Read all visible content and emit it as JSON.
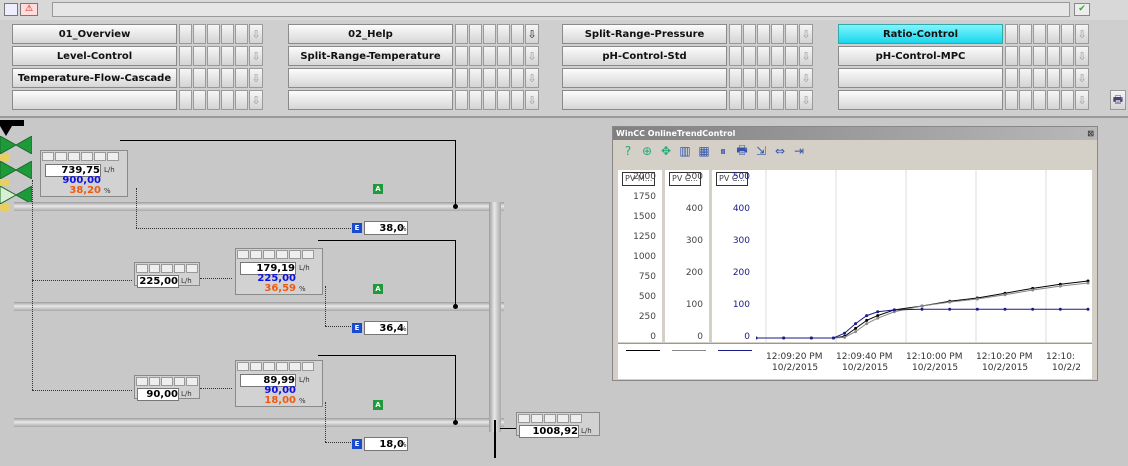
{
  "nav": {
    "rows": [
      [
        "01_Overview",
        "02_Help",
        "Split-Range-Pressure",
        "Ratio-Control"
      ],
      [
        "Level-Control",
        "Split-Range-Temperature",
        "pH-Control-Std",
        "pH-Control-MPC"
      ],
      [
        "Temperature-Flow-Cascade",
        "",
        "",
        ""
      ],
      [
        "",
        "",
        "",
        ""
      ]
    ],
    "active": "Ratio-Control",
    "arrow_glyph": "⇩"
  },
  "process": {
    "fic1": {
      "pv": "739,75",
      "sp": "900,00",
      "out": "38,20",
      "unit": "L/h",
      "out_unit": "%",
      "valve_out": "38,0",
      "valve_out_unit": "%"
    },
    "fic2": {
      "pv": "179,19",
      "sp": "225,00",
      "out": "36,59",
      "unit": "L/h",
      "out_unit": "%",
      "valve_out": "36,4",
      "valve_out_unit": "%"
    },
    "ratio2": {
      "value": "225,00",
      "unit": "L/h"
    },
    "fic3": {
      "pv": "89,99",
      "sp": "90,00",
      "out": "18,00",
      "unit": "L/h",
      "out_unit": "%",
      "valve_out": "18,0",
      "valve_out_unit": "%"
    },
    "ratio3": {
      "value": "90,00",
      "unit": "L/h"
    },
    "total": {
      "value": "1008,92",
      "unit": "L/h"
    },
    "tag_auto": "A",
    "tag_ext": "E"
  },
  "trend": {
    "title": "WinCC OnlineTrendControl",
    "close_glyph": "⊠",
    "toolbar_icons": [
      "help-icon",
      "zoom-icon",
      "move-icon",
      "ruler-icon",
      "table-icon",
      "pause-icon",
      "print-icon",
      "export-icon",
      "stats-icon",
      "range-icon"
    ],
    "toolbar_glyphs": [
      "?",
      "⊕",
      "✥",
      "▥",
      "▦",
      "⏸",
      "🖶",
      "⇲",
      "⇔",
      "⇥"
    ],
    "axis_labels": [
      "PV M...",
      "PV C...",
      "PV C..."
    ],
    "axis1_ticks": [
      "2000",
      "1750",
      "1500",
      "1250",
      "1000",
      "750",
      "500",
      "250",
      "0"
    ],
    "axis2_ticks": [
      "500",
      "400",
      "300",
      "200",
      "100",
      "0"
    ],
    "axis3_ticks": [
      "500",
      "400",
      "300",
      "200",
      "100",
      "0"
    ],
    "colors": {
      "series1": "#000000",
      "series2": "#888888",
      "series3": "#1a1a8a"
    }
  },
  "chart_data": {
    "type": "line",
    "x": [
      "12:09:20 PM\n10/2/2015",
      "12:09:40 PM\n10/2/2015",
      "12:10:00 PM\n10/2/2015",
      "12:10:20 PM\n10/2/2015",
      "12:10:..."
    ],
    "x_tick_times": [
      "12:09:20 PM",
      "12:09:40 PM",
      "12:10:00 PM",
      "12:10:20 PM",
      "12:10:"
    ],
    "x_tick_dates": [
      "10/2/2015",
      "10/2/2015",
      "10/2/2015",
      "10/2/2015",
      "10/2/2"
    ],
    "series": [
      {
        "x": [
          0,
          5,
          10,
          14,
          16,
          18,
          20,
          22,
          25,
          30,
          35,
          40,
          45,
          50,
          55,
          60
        ],
        "values": [
          0,
          0,
          0,
          0,
          5,
          30,
          55,
          70,
          88,
          100,
          115,
          125,
          140,
          155,
          168,
          178
        ],
        "color": "#000000"
      },
      {
        "x": [
          0,
          5,
          10,
          14,
          16,
          18,
          20,
          22,
          25,
          30,
          35,
          40,
          45,
          50,
          55,
          60
        ],
        "values": [
          0,
          0,
          0,
          0,
          2,
          20,
          45,
          62,
          82,
          100,
          112,
          122,
          135,
          150,
          162,
          172
        ],
        "color": "#888888"
      },
      {
        "x": [
          0,
          5,
          10,
          14,
          16,
          18,
          20,
          22,
          25,
          30,
          35,
          40,
          45,
          50,
          55,
          60
        ],
        "values": [
          0,
          0,
          0,
          0,
          15,
          45,
          70,
          82,
          88,
          90,
          90,
          90,
          90,
          90,
          90,
          90
        ],
        "color": "#1a1a8a"
      }
    ],
    "ylim": [
      0,
      500
    ]
  }
}
